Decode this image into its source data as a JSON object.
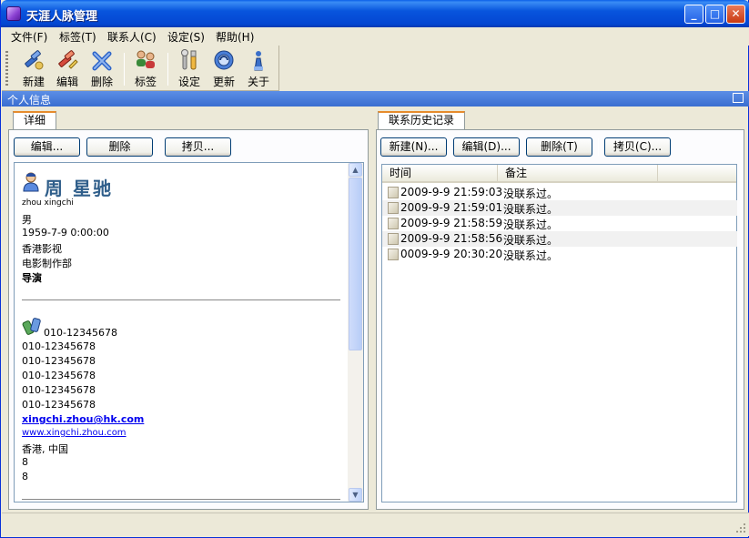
{
  "window": {
    "title": "天涯人脉管理"
  },
  "menu": [
    "文件(F)",
    "标签(T)",
    "联系人(C)",
    "设定(S)",
    "帮助(H)"
  ],
  "toolbar": {
    "new": "新建",
    "edit": "编辑",
    "delete": "删除",
    "tag": "标签",
    "settings": "设定",
    "update": "更新",
    "about": "关于"
  },
  "section_title": "个人信息",
  "left": {
    "tab": "详细",
    "buttons": {
      "edit": "编辑...",
      "delete": "删除",
      "copy": "拷贝..."
    },
    "detail": {
      "name": "周 星驰",
      "pinyin": "zhou xingchi",
      "gender": "男",
      "birthday": "1959-7-9 0:00:00",
      "company": "香港影视",
      "department": "电影制作部",
      "title": "导演",
      "phones": [
        "010-12345678",
        "010-12345678",
        "010-12345678",
        "010-12345678",
        "010-12345678",
        "010-12345678"
      ],
      "email": "xingchi.zhou@hk.com",
      "website": "www.xingchi.zhou.com",
      "location": "香港, 中国",
      "extra1": "8",
      "extra2": "8"
    }
  },
  "right": {
    "tab": "联系历史记录",
    "buttons": {
      "new": "新建(N)...",
      "edit": "编辑(D)...",
      "delete": "删除(T)",
      "copy": "拷贝(C)..."
    },
    "columns": [
      "时间",
      "备注"
    ],
    "rows": [
      {
        "time": "2009-9-9 21:59:03",
        "note": "没联系过。"
      },
      {
        "time": "2009-9-9 21:59:01",
        "note": "没联系过。"
      },
      {
        "time": "2009-9-9 21:58:59",
        "note": "没联系过。"
      },
      {
        "time": "2009-9-9 21:58:56",
        "note": "没联系过。"
      },
      {
        "time": "0009-9-9 20:30:20",
        "note": "没联系过。"
      }
    ]
  }
}
